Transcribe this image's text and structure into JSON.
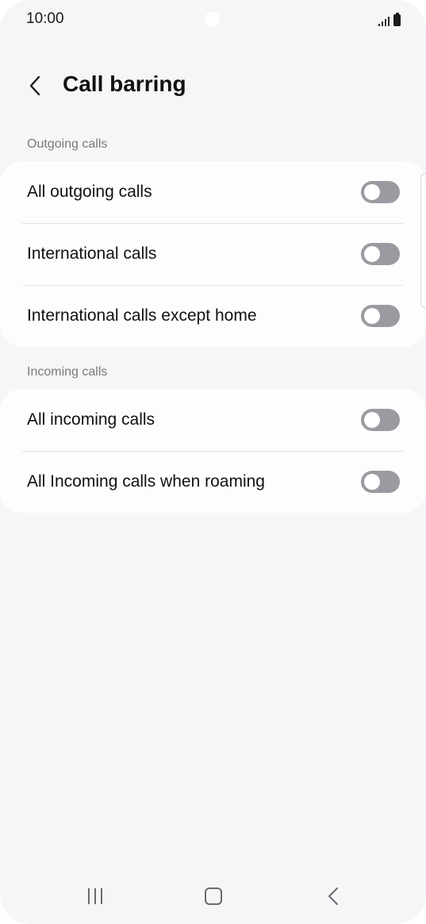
{
  "status_bar": {
    "time": "10:00"
  },
  "header": {
    "title": "Call barring",
    "back_icon": "chevron-left-icon"
  },
  "sections": [
    {
      "label": "Outgoing calls",
      "items": [
        {
          "label": "All outgoing calls",
          "enabled": false
        },
        {
          "label": "International calls",
          "enabled": false
        },
        {
          "label": "International calls except home",
          "enabled": false
        }
      ]
    },
    {
      "label": "Incoming calls",
      "items": [
        {
          "label": "All incoming calls",
          "enabled": false
        },
        {
          "label": "All Incoming calls when roaming",
          "enabled": false
        }
      ]
    }
  ],
  "nav_bar": {
    "recent_icon": "recent-apps-icon",
    "home_icon": "home-icon",
    "back_icon": "back-icon"
  },
  "colors": {
    "background": "#f6f6f8",
    "card": "#fdfdfe",
    "toggle_off": "#9a9aa0",
    "section_label": "#7a7a7e"
  }
}
